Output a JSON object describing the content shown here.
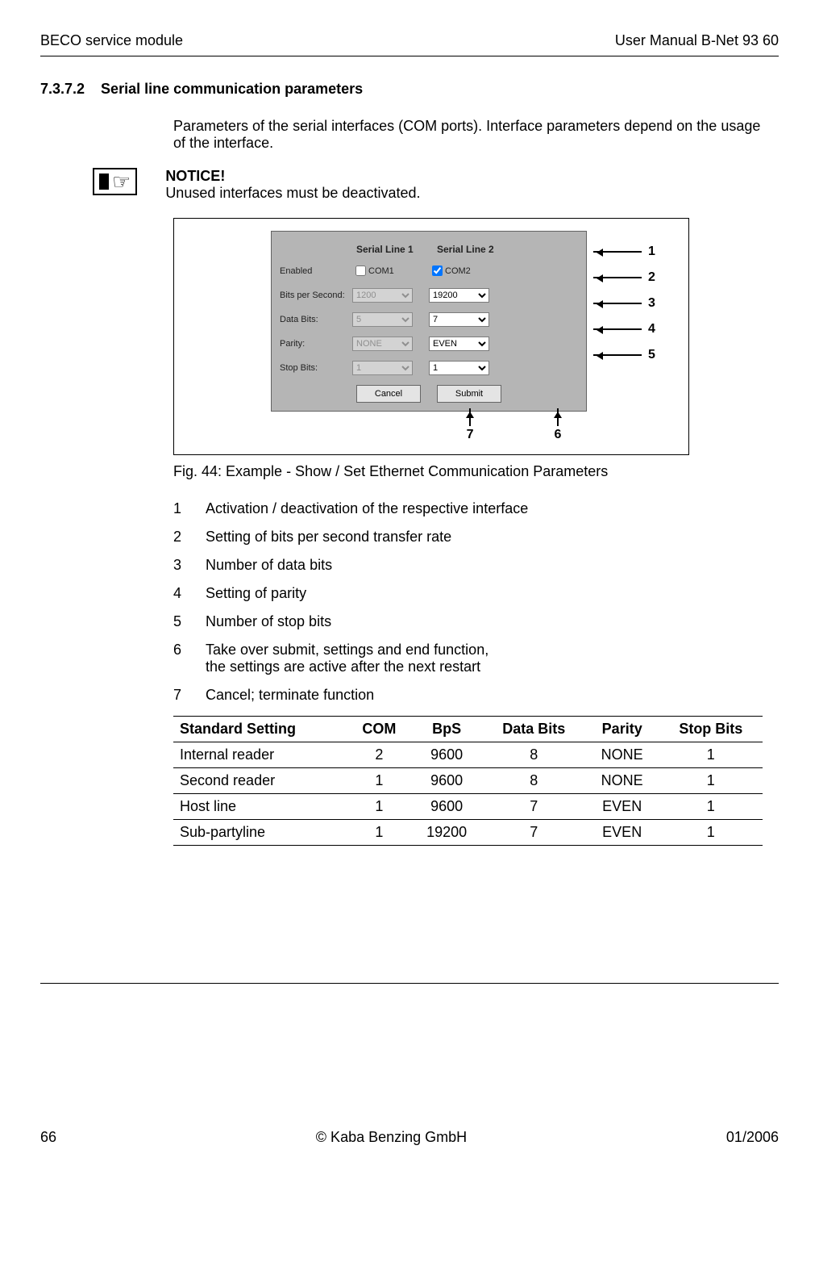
{
  "header": {
    "left": "BECO service module",
    "right": "User Manual B-Net 93 60"
  },
  "section": {
    "number": "7.3.7.2",
    "title": "Serial line communication parameters"
  },
  "intro": "Parameters of the serial interfaces (COM ports). Interface parameters depend on the usage of the interface.",
  "notice": {
    "heading": "NOTICE!",
    "body": "Unused interfaces must be deactivated."
  },
  "panel": {
    "col1": "Serial Line 1",
    "col2": "Serial Line 2",
    "rows": {
      "enabled": "Enabled",
      "bps": "Bits per Second:",
      "databits": "Data Bits:",
      "parity": "Parity:",
      "stopbits": "Stop Bits:"
    },
    "values": {
      "com1": "COM1",
      "com2": "COM2",
      "bps1": "1200",
      "bps2": "19200",
      "db1": "5",
      "db2": "7",
      "par1": "NONE",
      "par2": "EVEN",
      "sb1": "1",
      "sb2": "1"
    },
    "cancel": "Cancel",
    "submit": "Submit"
  },
  "callouts": {
    "r1": "1",
    "r2": "2",
    "r3": "3",
    "r4": "4",
    "r5": "5",
    "b6": "6",
    "b7": "7"
  },
  "figcaption": "Fig. 44: Example - Show / Set Ethernet Communication Parameters",
  "legend": {
    "1": "Activation / deactivation of the respective interface",
    "2": "Setting of bits per second transfer rate",
    "3": "Number of data bits",
    "4": "Setting of parity",
    "5": "Number of stop bits",
    "6": "Take over submit, settings and end function,\nthe settings are active after the next restart",
    "7": "Cancel; terminate function"
  },
  "table": {
    "headers": {
      "setting": "Standard Setting",
      "com": "COM",
      "bps": "BpS",
      "databits": "Data Bits",
      "parity": "Parity",
      "stopbits": "Stop Bits"
    },
    "rows": [
      {
        "setting": "Internal reader",
        "com": "2",
        "bps": "9600",
        "databits": "8",
        "parity": "NONE",
        "stopbits": "1"
      },
      {
        "setting": "Second reader",
        "com": "1",
        "bps": "9600",
        "databits": "8",
        "parity": "NONE",
        "stopbits": "1"
      },
      {
        "setting": "Host line",
        "com": "1",
        "bps": "9600",
        "databits": "7",
        "parity": "EVEN",
        "stopbits": "1"
      },
      {
        "setting": "Sub-partyline",
        "com": "1",
        "bps": "19200",
        "databits": "7",
        "parity": "EVEN",
        "stopbits": "1"
      }
    ]
  },
  "footer": {
    "left": "66",
    "center": "© Kaba Benzing GmbH",
    "right": "01/2006"
  }
}
